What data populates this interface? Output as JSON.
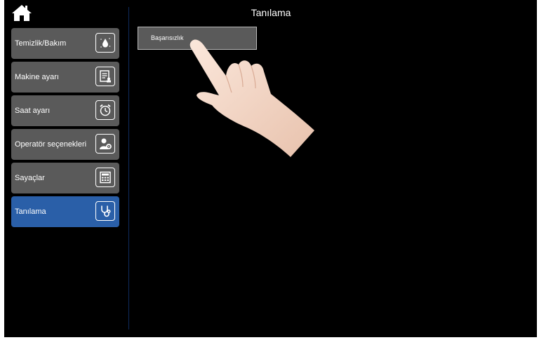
{
  "header": {
    "title": "Tanılama"
  },
  "icons": {
    "home": "home-icon",
    "hand": "pointing-hand"
  },
  "menu": {
    "items": [
      {
        "label": "Temizlik/Bakım",
        "icon": "water-drop-icon"
      },
      {
        "label": "Makine ayarı",
        "icon": "machine-settings-icon"
      },
      {
        "label": "Saat ayarı",
        "icon": "alarm-clock-icon"
      },
      {
        "label": "Operatör seçenekleri",
        "icon": "operator-settings-icon"
      },
      {
        "label": "Sayaçlar",
        "icon": "counter-icon"
      },
      {
        "label": "Tanılama",
        "icon": "stethoscope-icon",
        "active": true
      }
    ]
  },
  "main": {
    "buttons": [
      {
        "label": "Başarısızlık"
      }
    ]
  },
  "colors": {
    "active": "#2a5fa8",
    "item": "#5a5a5a",
    "background": "#000000"
  }
}
